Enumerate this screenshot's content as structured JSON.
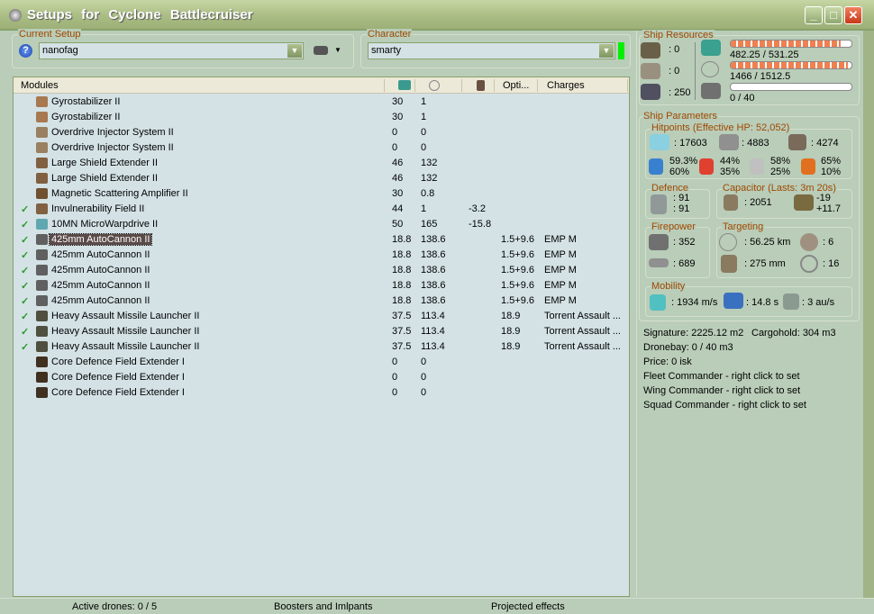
{
  "window": {
    "title": "Setups  for  Cyclone  Battlecruiser",
    "min": "_",
    "max": "□",
    "close": "✕"
  },
  "setup": {
    "legend": "Current Setup",
    "value": "nanofag"
  },
  "character": {
    "legend": "Character",
    "value": "smarty"
  },
  "list": {
    "headers": {
      "modules": "Modules",
      "opti": "Opti...",
      "charges": "Charges"
    },
    "rows": [
      {
        "checked": false,
        "name": "Gyrostabilizer II",
        "cpu": "30",
        "pg": "1",
        "cap": "",
        "opti": "",
        "charge": "",
        "icon": "#a87850"
      },
      {
        "checked": false,
        "name": "Gyrostabilizer II",
        "cpu": "30",
        "pg": "1",
        "cap": "",
        "opti": "",
        "charge": "",
        "icon": "#a87850"
      },
      {
        "checked": false,
        "name": "Overdrive Injector System II",
        "cpu": "0",
        "pg": "0",
        "cap": "",
        "opti": "",
        "charge": "",
        "icon": "#9a8060"
      },
      {
        "checked": false,
        "name": "Overdrive Injector System II",
        "cpu": "0",
        "pg": "0",
        "cap": "",
        "opti": "",
        "charge": "",
        "icon": "#9a8060"
      },
      {
        "checked": false,
        "name": "Large Shield Extender II",
        "cpu": "46",
        "pg": "132",
        "cap": "",
        "opti": "",
        "charge": "",
        "icon": "#806040"
      },
      {
        "checked": false,
        "name": "Large Shield Extender II",
        "cpu": "46",
        "pg": "132",
        "cap": "",
        "opti": "",
        "charge": "",
        "icon": "#806040"
      },
      {
        "checked": false,
        "name": "Magnetic Scattering Amplifier II",
        "cpu": "30",
        "pg": "0.8",
        "cap": "",
        "opti": "",
        "charge": "",
        "icon": "#705030"
      },
      {
        "checked": true,
        "name": "Invulnerability Field II",
        "cpu": "44",
        "pg": "1",
        "cap": "-3.2",
        "opti": "",
        "charge": "",
        "icon": "#806040"
      },
      {
        "checked": true,
        "name": "10MN MicroWarpdrive II",
        "cpu": "50",
        "pg": "165",
        "cap": "-15.8",
        "opti": "",
        "charge": "",
        "icon": "#60a8b0"
      },
      {
        "checked": true,
        "name": "425mm AutoCannon II",
        "cpu": "18.8",
        "pg": "138.6",
        "cap": "",
        "opti": "1.5+9.6",
        "charge": "EMP M",
        "icon": "#606060",
        "selected": true
      },
      {
        "checked": true,
        "name": "425mm AutoCannon II",
        "cpu": "18.8",
        "pg": "138.6",
        "cap": "",
        "opti": "1.5+9.6",
        "charge": "EMP M",
        "icon": "#606060"
      },
      {
        "checked": true,
        "name": "425mm AutoCannon II",
        "cpu": "18.8",
        "pg": "138.6",
        "cap": "",
        "opti": "1.5+9.6",
        "charge": "EMP M",
        "icon": "#606060"
      },
      {
        "checked": true,
        "name": "425mm AutoCannon II",
        "cpu": "18.8",
        "pg": "138.6",
        "cap": "",
        "opti": "1.5+9.6",
        "charge": "EMP M",
        "icon": "#606060"
      },
      {
        "checked": true,
        "name": "425mm AutoCannon II",
        "cpu": "18.8",
        "pg": "138.6",
        "cap": "",
        "opti": "1.5+9.6",
        "charge": "EMP M",
        "icon": "#606060"
      },
      {
        "checked": true,
        "name": "Heavy Assault Missile Launcher II",
        "cpu": "37.5",
        "pg": "113.4",
        "cap": "",
        "opti": "18.9",
        "charge": "Torrent Assault ...",
        "icon": "#505040"
      },
      {
        "checked": true,
        "name": "Heavy Assault Missile Launcher II",
        "cpu": "37.5",
        "pg": "113.4",
        "cap": "",
        "opti": "18.9",
        "charge": "Torrent Assault ...",
        "icon": "#505040"
      },
      {
        "checked": true,
        "name": "Heavy Assault Missile Launcher II",
        "cpu": "37.5",
        "pg": "113.4",
        "cap": "",
        "opti": "18.9",
        "charge": "Torrent Assault ...",
        "icon": "#505040"
      },
      {
        "checked": false,
        "name": "Core Defence Field Extender I",
        "cpu": "0",
        "pg": "0",
        "cap": "",
        "opti": "",
        "charge": "",
        "icon": "#403020"
      },
      {
        "checked": false,
        "name": "Core Defence Field Extender I",
        "cpu": "0",
        "pg": "0",
        "cap": "",
        "opti": "",
        "charge": "",
        "icon": "#403020"
      },
      {
        "checked": false,
        "name": "Core Defence Field Extender I",
        "cpu": "0",
        "pg": "0",
        "cap": "",
        "opti": "",
        "charge": "",
        "icon": "#403020"
      }
    ]
  },
  "resources": {
    "legend": "Ship Resources",
    "turrets": ": 0",
    "launchers": ": 0",
    "calibration": ": 250",
    "cpu": "482.25 / 531.25",
    "cpu_frac": 0.908,
    "pg": "1466 / 1512.5",
    "pg_frac": 0.969,
    "drone": "0 / 40",
    "drone_frac": 0
  },
  "params": {
    "legend": "Ship Parameters",
    "hp_legend": "Hitpoints (Effective HP: 52,052)",
    "shield": ": 17603",
    "armor": ": 4883",
    "hull": ": 4274",
    "res": [
      [
        "59.3%",
        "60%"
      ],
      [
        "44%",
        "35%"
      ],
      [
        "58%",
        "25%"
      ],
      [
        "65%",
        "10%"
      ]
    ],
    "defence_legend": "Defence",
    "def1": ": 91",
    "def2": ": 91",
    "cap_legend": "Capacitor (Lasts: 3m 20s)",
    "cap": ": 2051",
    "cap_use": "-19",
    "cap_rec": "+11.7",
    "fire_legend": "Firepower",
    "turret_dps": ": 352",
    "missile_dps": ": 689",
    "target_legend": "Targeting",
    "range": ": 56.25 km",
    "targets": ": 6",
    "scan": ": 275 mm",
    "sensor": ": 16",
    "mob_legend": "Mobility",
    "speed": ": 1934 m/s",
    "align": ": 14.8 s",
    "warp": ": 3 au/s"
  },
  "info": {
    "sig": "Signature: 2225.12 m2",
    "cargo": "Cargohold: 304 m3",
    "dronebay": "Dronebay: 0 / 40 m3",
    "price": "Price: 0 isk",
    "fleet": "Fleet Commander - right click to set",
    "wing": "Wing Commander - right click to set",
    "squad": "Squad Commander - right click to set"
  },
  "status": {
    "drones": "Active drones: 0 / 5",
    "boosters": "Boosters and Imlpants",
    "projected": "Projected effects"
  }
}
